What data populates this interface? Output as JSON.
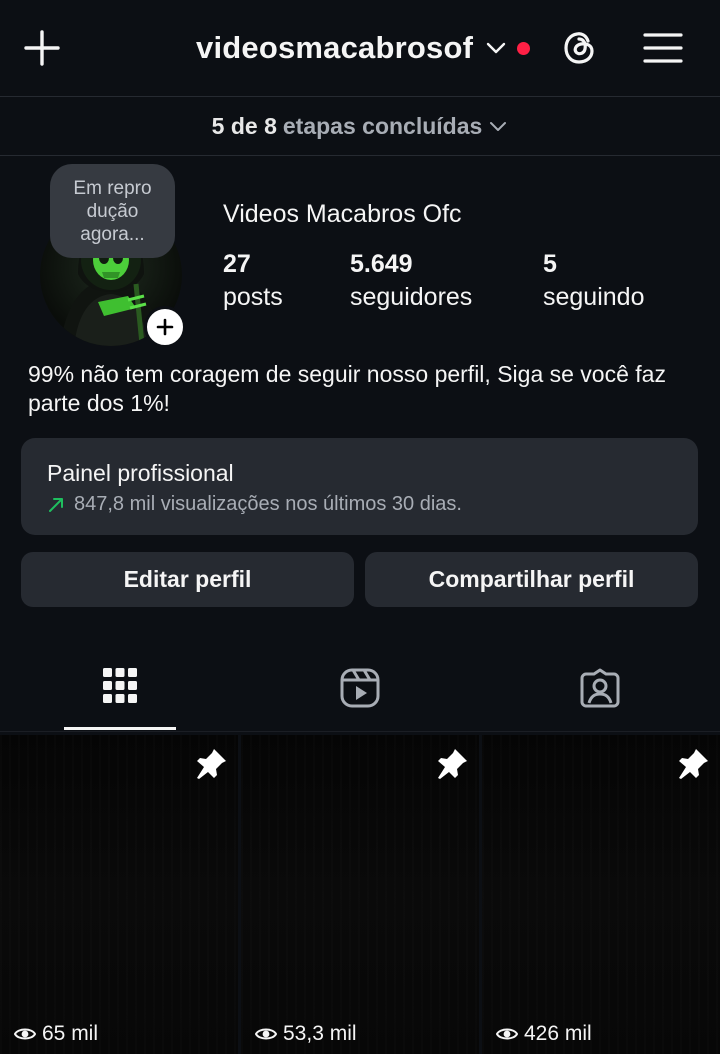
{
  "header": {
    "username": "videosmacabrosof",
    "icons": {
      "new_post": "plus-icon",
      "switch_account": "chevron-down-icon",
      "threads": "threads-icon",
      "menu": "hamburger-menu-icon"
    },
    "notification_dot_color": "#ff2045"
  },
  "onboarding": {
    "done": "5 de 8",
    "rest": "etapas concluídas"
  },
  "profile": {
    "note": "Em repro dução agora...",
    "name": "Videos Macabros Ofc",
    "stats": [
      {
        "value": "27",
        "label": "posts"
      },
      {
        "value": "5.649",
        "label": "seguidores"
      },
      {
        "value": "5",
        "label": "seguindo"
      }
    ],
    "bio": "99%  não tem coragem de seguir nosso perfil, Siga se você faz parte dos 1%!"
  },
  "professional_panel": {
    "title": "Painel profissional",
    "subtitle": "847,8 mil visualizações nos últimos 30 dias.",
    "trend_color": "#1fbf5f"
  },
  "actions": {
    "edit": "Editar perfil",
    "share": "Compartilhar perfil"
  },
  "tabs": [
    {
      "icon": "grid-icon",
      "active": true
    },
    {
      "icon": "reels-icon",
      "active": false
    },
    {
      "icon": "tagged-icon",
      "active": false
    }
  ],
  "posts": [
    {
      "views": "65 mil",
      "pinned": true
    },
    {
      "views": "53,3 mil",
      "pinned": true
    },
    {
      "views": "426 mil",
      "pinned": true
    }
  ],
  "colors": {
    "background": "#0c0f14",
    "surface": "#262a31",
    "text": "#f5f5f5",
    "muted": "#a8adb5"
  }
}
